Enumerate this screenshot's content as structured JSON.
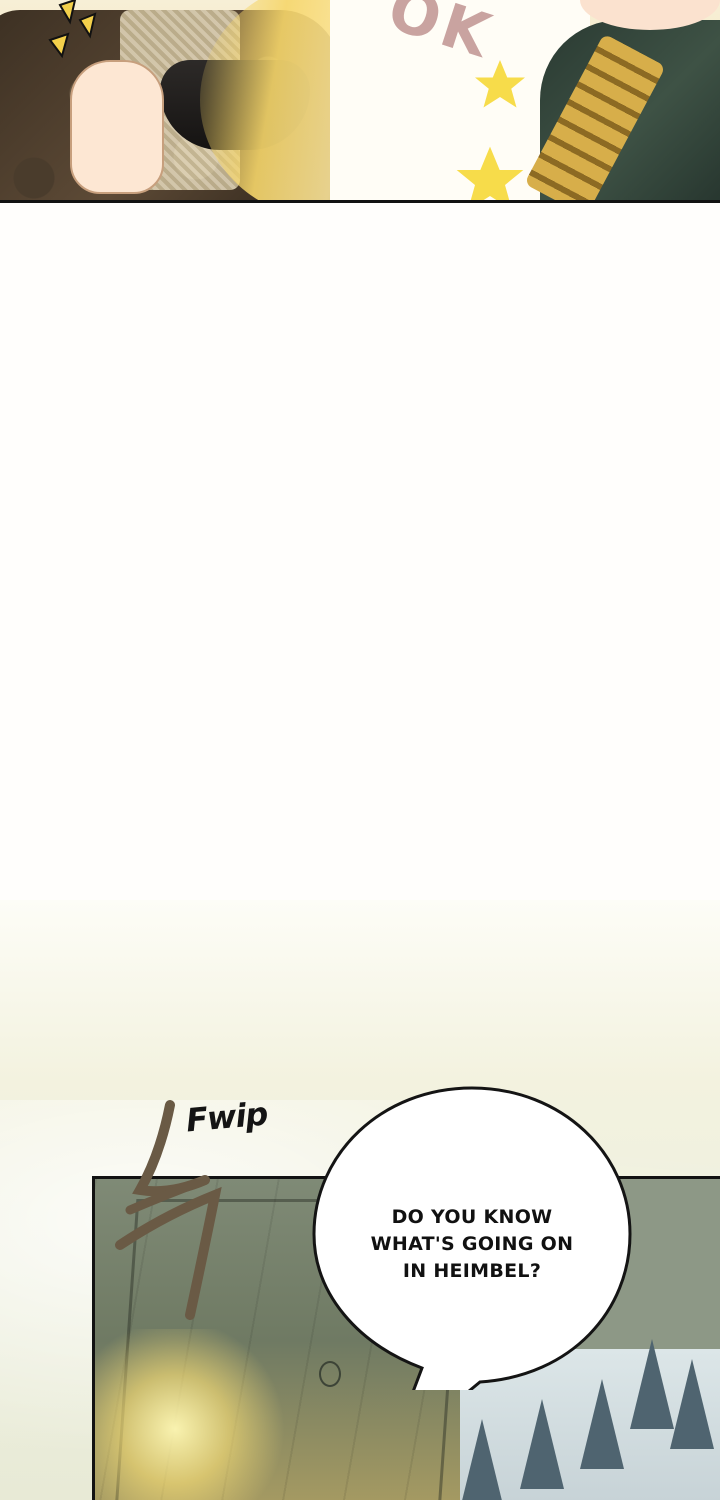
{
  "top_panel": {
    "sfx_text": "OK"
  },
  "sound_effect": {
    "text": "Fwip"
  },
  "speech_bubble": {
    "lines": [
      "DO YOU KNOW",
      "WHAT'S GOING ON",
      "IN HEIMBEL?"
    ]
  },
  "colors": {
    "panel_border": "#121212",
    "page_background": "#fffefc",
    "hair_gold": "#f6d66a",
    "uniform_green": "#2a3a32",
    "door_green": "#7f8a76",
    "forest_blue": "#4f6470",
    "star_yellow": "#f7dc4a"
  },
  "icons": {
    "stars": "star-icon",
    "speed_lines": "speed-lines-icon",
    "door_knob": "door-knob-icon"
  }
}
